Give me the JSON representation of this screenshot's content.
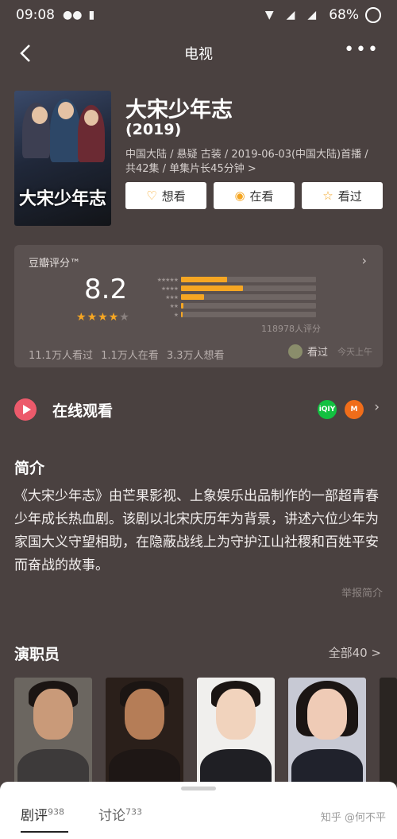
{
  "status_bar": {
    "time": "09:08",
    "battery": "68%"
  },
  "nav": {
    "title": "电视"
  },
  "movie": {
    "title": "大宋少年志",
    "year": "(2019)",
    "meta_line1": "中国大陆 / 悬疑 古装 / 2019-06-03(中国大陆)首播 /",
    "meta_line2": "共42集 / 单集片长45分钟 >",
    "poster_title": "大宋少年志"
  },
  "actions": {
    "want": "想看",
    "watching": "在看",
    "watched": "看过"
  },
  "rating": {
    "label": "豆瓣评分™",
    "score": "8.2",
    "stars_filled": 4,
    "distribution": [
      {
        "stars": 5,
        "fraction": 0.34
      },
      {
        "stars": 4,
        "fraction": 0.46
      },
      {
        "stars": 3,
        "fraction": 0.17
      },
      {
        "stars": 2,
        "fraction": 0.02
      },
      {
        "stars": 1,
        "fraction": 0.01
      }
    ],
    "count": "118978人评分",
    "stats": "11.1万人看过  1.1万人在看  3.3万人想看",
    "seen_label": "看过",
    "seen_time": "今天上午"
  },
  "online": {
    "label": "在线观看",
    "src1": "iQIY",
    "src2": "M"
  },
  "summary": {
    "title": "简介",
    "text": "《大宋少年志》由芒果影视、上象娱乐出品制作的一部超青春少年成长热血剧。该剧以北宋庆历年为背景，讲述六位少年为家国大义守望相助，在隐蔽战线上为守护江山社稷和百姓平安而奋战的故事。",
    "report": "举报简介"
  },
  "cast": {
    "title": "演职员",
    "all": "全部40 >"
  },
  "bottom": {
    "tab1": "剧评",
    "tab1_count": "938",
    "tab2": "讨论",
    "tab2_count": "733",
    "watermark": "知乎 @何不平"
  }
}
